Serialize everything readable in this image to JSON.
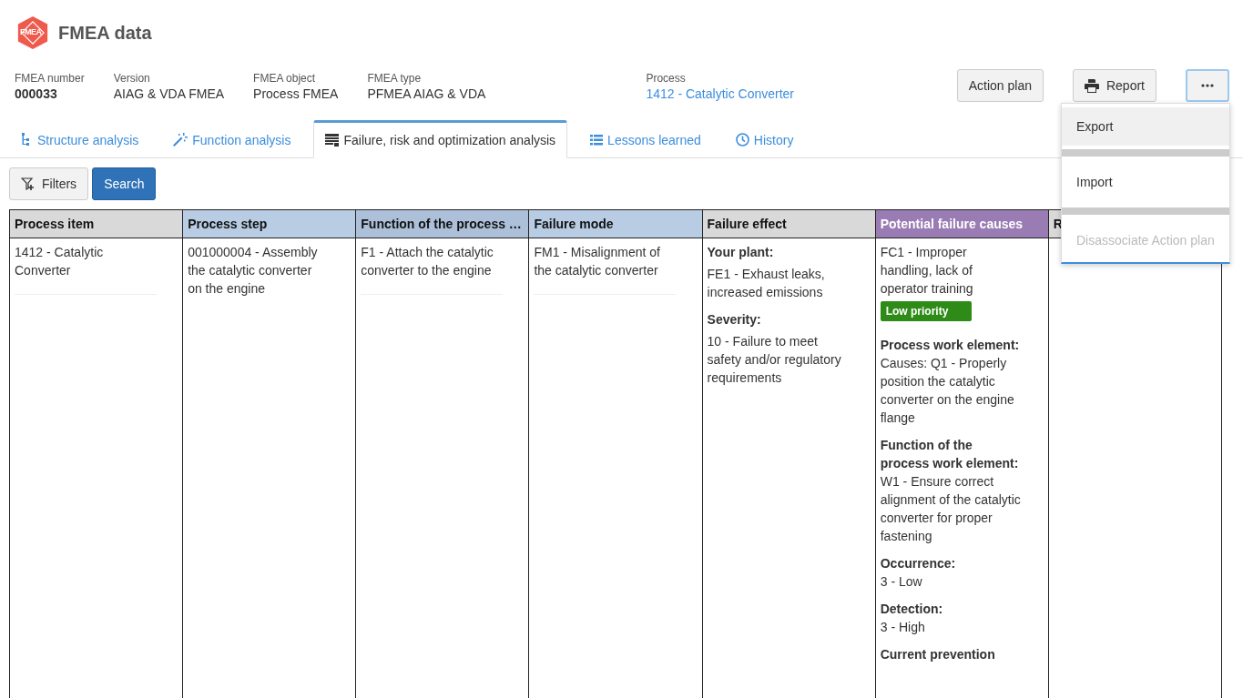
{
  "app": {
    "logo_text": "FMEA",
    "title": "FMEA data"
  },
  "meta": [
    {
      "label": "FMEA number",
      "value": "000033",
      "kind": "bold"
    },
    {
      "label": "Version",
      "value": "AIAG & VDA FMEA",
      "kind": "plain"
    },
    {
      "label": "FMEA object",
      "value": "Process FMEA",
      "kind": "plain"
    },
    {
      "label": "FMEA type",
      "value": "PFMEA AIAG & VDA",
      "kind": "plain"
    },
    {
      "label": "Process",
      "value": "1412 - Catalytic Converter",
      "kind": "link"
    }
  ],
  "actions": [
    {
      "label": "Action plan",
      "kind": "text"
    },
    {
      "label": "Report",
      "kind": "print"
    },
    {
      "kind": "more",
      "focused": true
    }
  ],
  "menu": {
    "items": [
      {
        "label": "Export",
        "selected": true,
        "disabled": false
      },
      {
        "label": "Import",
        "selected": false,
        "disabled": false
      },
      {
        "label": "Disassociate Action plan",
        "selected": false,
        "disabled": true
      }
    ]
  },
  "tabs": [
    {
      "label": "Structure analysis",
      "kind": "tree",
      "selected": false
    },
    {
      "label": "Function analysis",
      "kind": "wand",
      "selected": false
    },
    {
      "label": "Failure, risk and optimization analysis",
      "kind": "table",
      "selected": true
    },
    {
      "label": "Lessons learned",
      "kind": "list",
      "selected": false
    },
    {
      "label": "History",
      "kind": "clock",
      "selected": false
    }
  ],
  "toolbar": {
    "filters": "Filters",
    "search": "Search"
  },
  "table": {
    "columns": [
      {
        "label": "Process item",
        "color": "#d9d9d9"
      },
      {
        "label": "Process step",
        "color": "#b8cce4"
      },
      {
        "label": "Function of the process …",
        "color": "#adc0d9"
      },
      {
        "label": "Failure mode",
        "color": "#b8cce4"
      },
      {
        "label": "Failure effect",
        "color": "#d9d9d9"
      },
      {
        "label": "Potential failure causes",
        "color": "#9a7cb4"
      },
      {
        "label": "R",
        "color": "#d9d9d9"
      }
    ],
    "rows": [
      {
        "cells": [
          [
            {
              "kind": "text",
              "text": "1412 - Catalytic Converter",
              "rule": true
            }
          ],
          [
            {
              "kind": "text",
              "text": "001000004 - Assembly the catalytic converter on the engine",
              "rule": false
            }
          ],
          [
            {
              "kind": "text",
              "text": "F1 - Attach the catalytic converter to the engine",
              "rule": true
            }
          ],
          [
            {
              "kind": "text",
              "text": "FM1 - Misalignment of the catalytic converter",
              "rule": true
            }
          ],
          [
            {
              "kind": "field",
              "label": "Your plant:",
              "value": "FE1 - Exhaust leaks, increased emissions"
            },
            {
              "kind": "field",
              "label": "Severity:",
              "value": "10 - Failure to meet safety and/or regulatory requirements"
            }
          ],
          [
            {
              "kind": "text",
              "text": "FC1 - Improper handling, lack of operator training",
              "rule": false
            },
            {
              "kind": "badge",
              "text": "Low priority",
              "color": "#2e8b17"
            },
            {
              "kind": "field",
              "label": "Process work element:",
              "value": "Causes: Q1 - Properly position the catalytic converter on the engine flange"
            },
            {
              "kind": "field",
              "label": "Function of the process work element:",
              "value": "W1 - Ensure correct alignment of the catalytic converter for proper fastening"
            },
            {
              "kind": "field",
              "label": "Occurrence:",
              "value": "3 - Low"
            },
            {
              "kind": "field",
              "label": "Detection:",
              "value": "3 - High"
            },
            {
              "kind": "field",
              "label": "Current prevention"
            }
          ],
          []
        ]
      }
    ]
  }
}
